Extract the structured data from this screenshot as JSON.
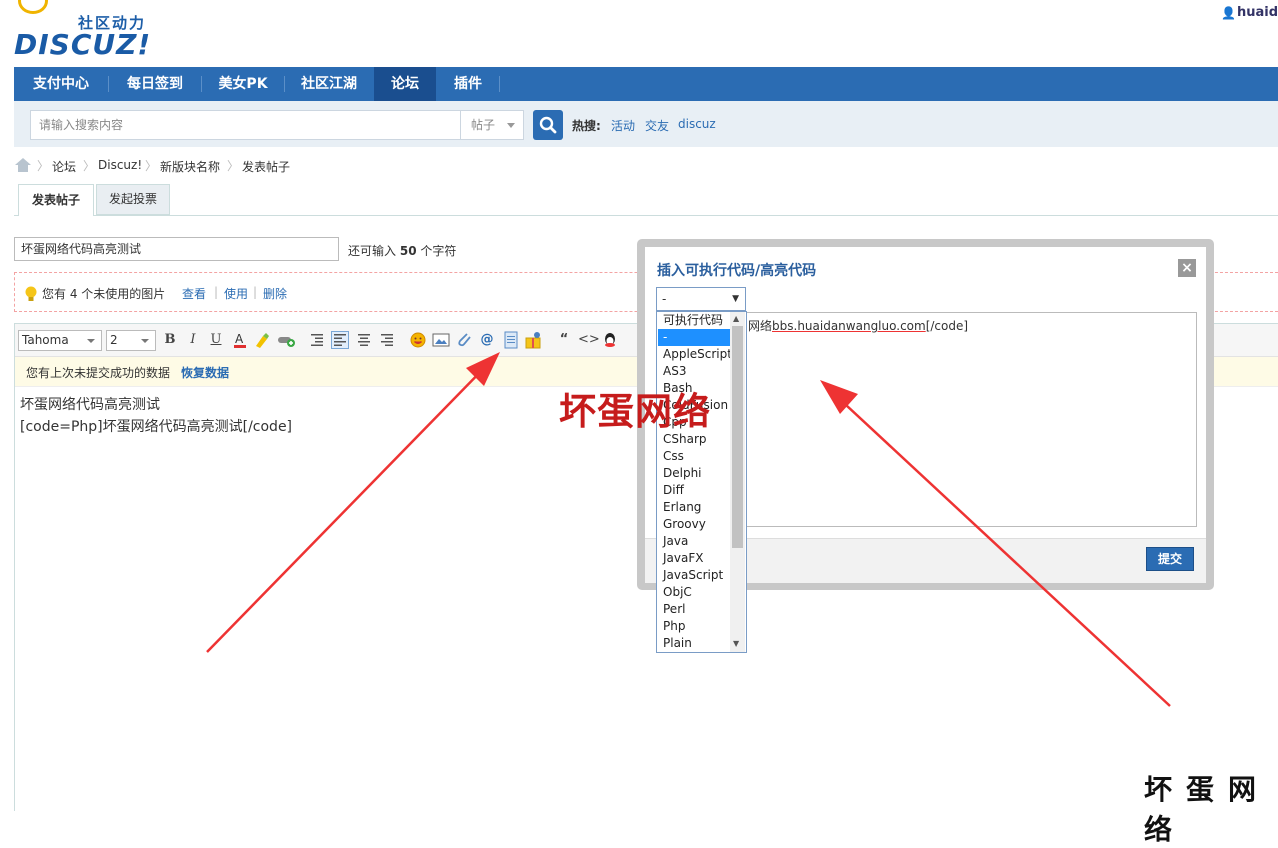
{
  "header": {
    "logo_sub": "社区动力",
    "logo_main": "DISCUZ!",
    "user": "huaid"
  },
  "nav": {
    "items": [
      "支付中心",
      "每日签到",
      "美女PK",
      "社区江湖",
      "论坛",
      "插件"
    ],
    "active": "论坛"
  },
  "search": {
    "placeholder": "请输入搜索内容",
    "type": "帖子",
    "hot_label": "热搜:",
    "hot_links": [
      "活动",
      "交友",
      "discuz"
    ]
  },
  "breadcrumb": [
    "论坛",
    "Discuz!",
    "新版块名称",
    "发表帖子"
  ],
  "tabs": [
    "发表帖子",
    "发起投票"
  ],
  "subject": {
    "value": "坏蛋网络代码高亮测试",
    "hint_prefix": "还可输入",
    "hint_count": "50",
    "hint_suffix": "个字符"
  },
  "images": {
    "text": "您有 4 个未使用的图片",
    "links": [
      "查看",
      "使用",
      "删除"
    ]
  },
  "toolbar": {
    "font": "Tahoma",
    "size": "2"
  },
  "restore": {
    "text": "您有上次未提交成功的数据",
    "link": "恢复数据"
  },
  "editor": {
    "line1": "坏蛋网络代码高亮测试",
    "line2": "[code=Php]坏蛋网络代码高亮测试[/code]"
  },
  "dialog": {
    "title": "插入可执行代码/高亮代码",
    "close": "×",
    "selected": "-",
    "code_prefix": "网络",
    "code_url": "bbs.huaidanwangluo.com",
    "code_suffix": "[/code]",
    "submit": "提交",
    "options": [
      "可执行代码",
      "-",
      "AppleScript",
      "AS3",
      "Bash",
      "ColdFusion",
      "Cpp",
      "CSharp",
      "Css",
      "Delphi",
      "Diff",
      "Erlang",
      "Groovy",
      "Java",
      "JavaFX",
      "JavaScript",
      "ObjC",
      "Perl",
      "Php",
      "Plain"
    ]
  },
  "watermarks": {
    "center": "坏蛋网络",
    "corner": "坏蛋网络"
  },
  "colors": {
    "nav_bg": "#2b6cb3",
    "nav_active": "#1a4e8f",
    "link": "#2b6cb3",
    "watermark_red": "#c61c1c",
    "arrow_red": "#ee3333"
  }
}
